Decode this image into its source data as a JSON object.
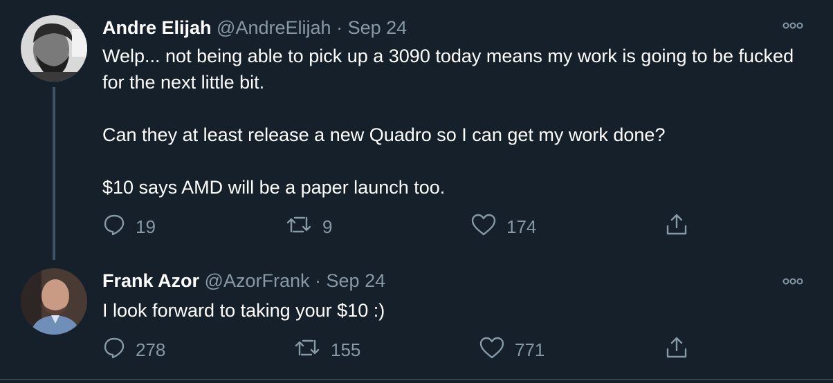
{
  "tweets": [
    {
      "name": "Andre Elijah",
      "handle": "@AndreElijah",
      "separator": "·",
      "date": "Sep 24",
      "text": [
        "Welp... not being able to pick up a 3090 today means my work is going to be fucked for the next little bit.",
        "Can they at least release a new Quadro so I can get my work done?",
        "$10 says AMD will be a paper launch too."
      ],
      "replies": "19",
      "retweets": "9",
      "likes": "174",
      "more_icon": "ellipsis-icon"
    },
    {
      "name": "Frank Azor",
      "handle": "@AzorFrank",
      "separator": "·",
      "date": "Sep 24",
      "text": [
        "I look forward to taking your $10 :)"
      ],
      "replies": "278",
      "retweets": "155",
      "likes": "771",
      "more_icon": "ellipsis-icon"
    }
  ],
  "colors": {
    "background": "#15202b",
    "primary_text": "#ffffff",
    "secondary_text": "#8899a6",
    "thread_line": "#3d5466"
  },
  "icons": [
    "reply-icon",
    "retweet-icon",
    "like-icon",
    "share-icon",
    "ellipsis-icon"
  ]
}
